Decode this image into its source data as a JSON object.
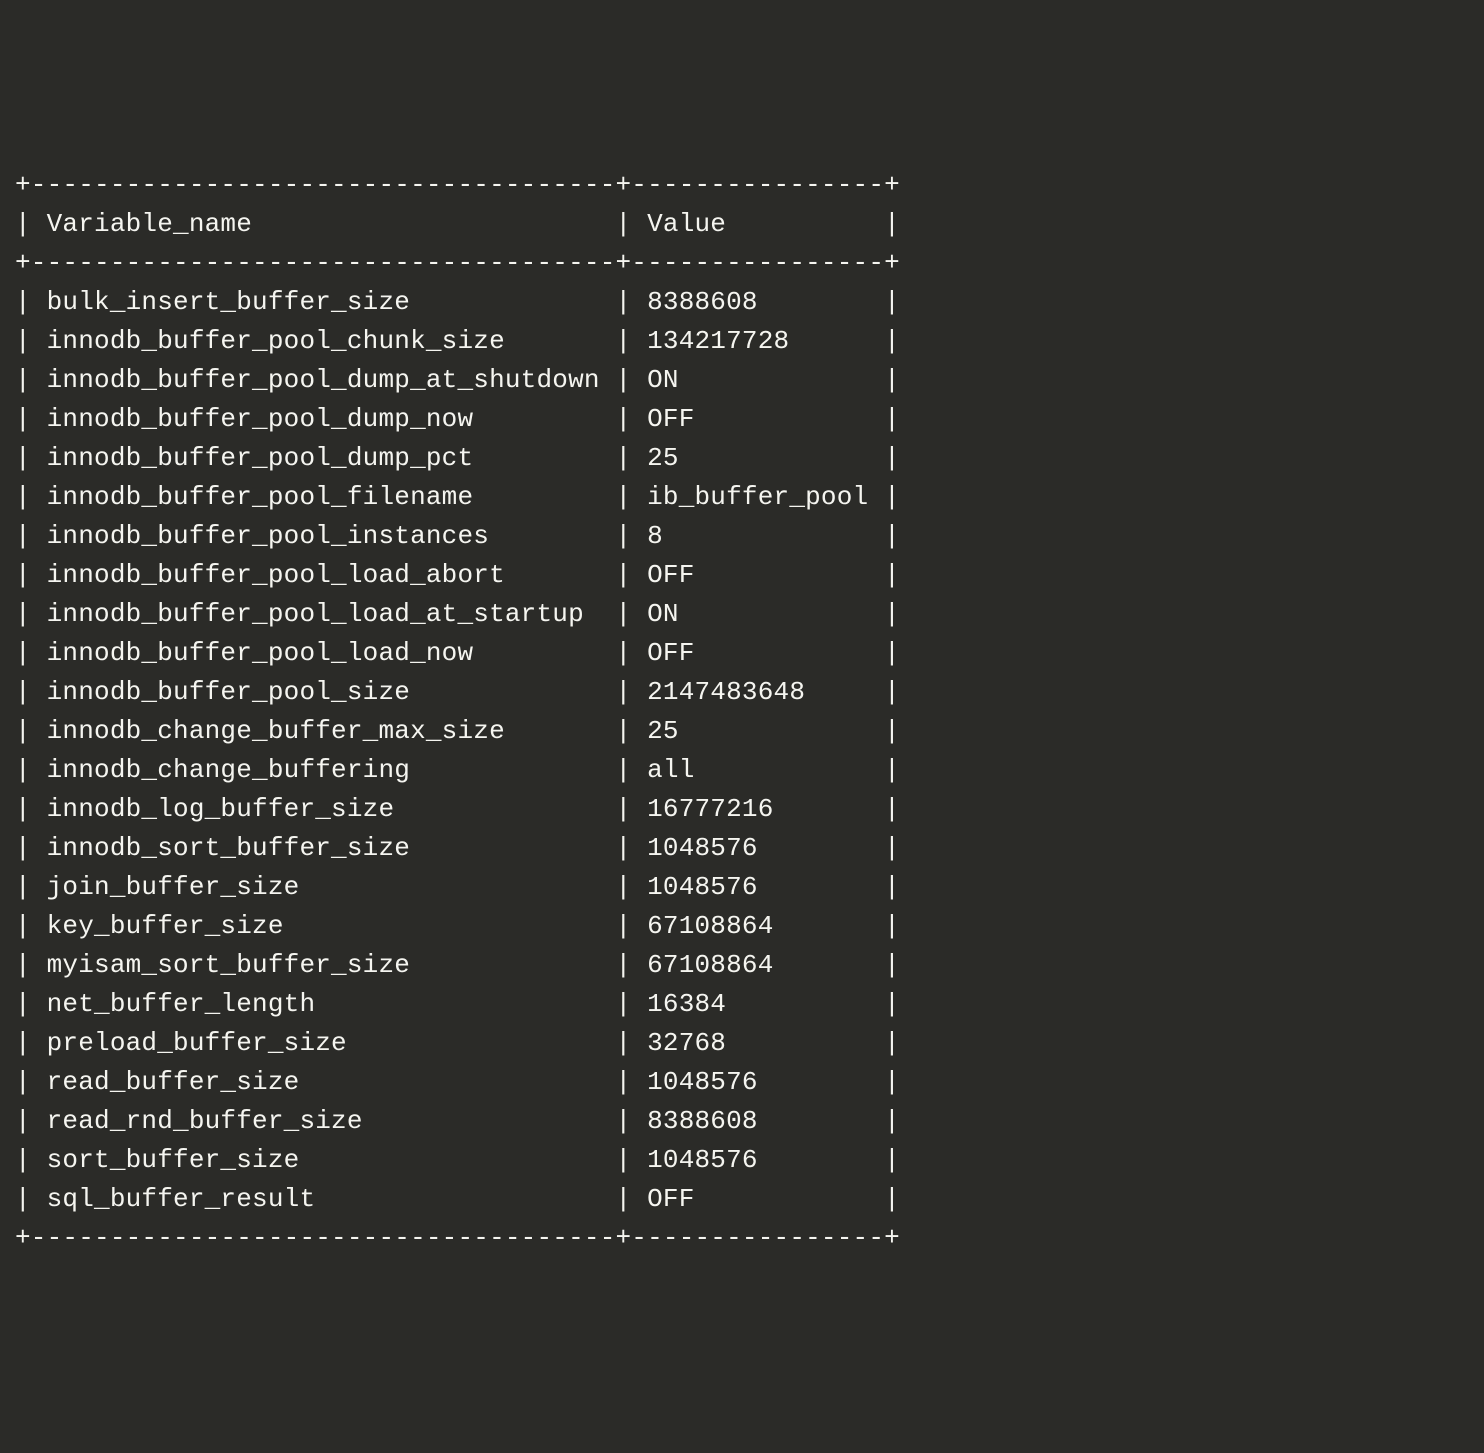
{
  "table": {
    "headers": {
      "col1": "Variable_name",
      "col2": "Value"
    },
    "col1_width": 37,
    "col2_width": 16,
    "rows": [
      {
        "name": "bulk_insert_buffer_size",
        "value": "8388608"
      },
      {
        "name": "innodb_buffer_pool_chunk_size",
        "value": "134217728"
      },
      {
        "name": "innodb_buffer_pool_dump_at_shutdown",
        "value": "ON"
      },
      {
        "name": "innodb_buffer_pool_dump_now",
        "value": "OFF"
      },
      {
        "name": "innodb_buffer_pool_dump_pct",
        "value": "25"
      },
      {
        "name": "innodb_buffer_pool_filename",
        "value": "ib_buffer_pool"
      },
      {
        "name": "innodb_buffer_pool_instances",
        "value": "8"
      },
      {
        "name": "innodb_buffer_pool_load_abort",
        "value": "OFF"
      },
      {
        "name": "innodb_buffer_pool_load_at_startup",
        "value": "ON"
      },
      {
        "name": "innodb_buffer_pool_load_now",
        "value": "OFF"
      },
      {
        "name": "innodb_buffer_pool_size",
        "value": "2147483648"
      },
      {
        "name": "innodb_change_buffer_max_size",
        "value": "25"
      },
      {
        "name": "innodb_change_buffering",
        "value": "all"
      },
      {
        "name": "innodb_log_buffer_size",
        "value": "16777216"
      },
      {
        "name": "innodb_sort_buffer_size",
        "value": "1048576"
      },
      {
        "name": "join_buffer_size",
        "value": "1048576"
      },
      {
        "name": "key_buffer_size",
        "value": "67108864"
      },
      {
        "name": "myisam_sort_buffer_size",
        "value": "67108864"
      },
      {
        "name": "net_buffer_length",
        "value": "16384"
      },
      {
        "name": "preload_buffer_size",
        "value": "32768"
      },
      {
        "name": "read_buffer_size",
        "value": "1048576"
      },
      {
        "name": "read_rnd_buffer_size",
        "value": "8388608"
      },
      {
        "name": "sort_buffer_size",
        "value": "1048576"
      },
      {
        "name": "sql_buffer_result",
        "value": "OFF"
      }
    ]
  }
}
